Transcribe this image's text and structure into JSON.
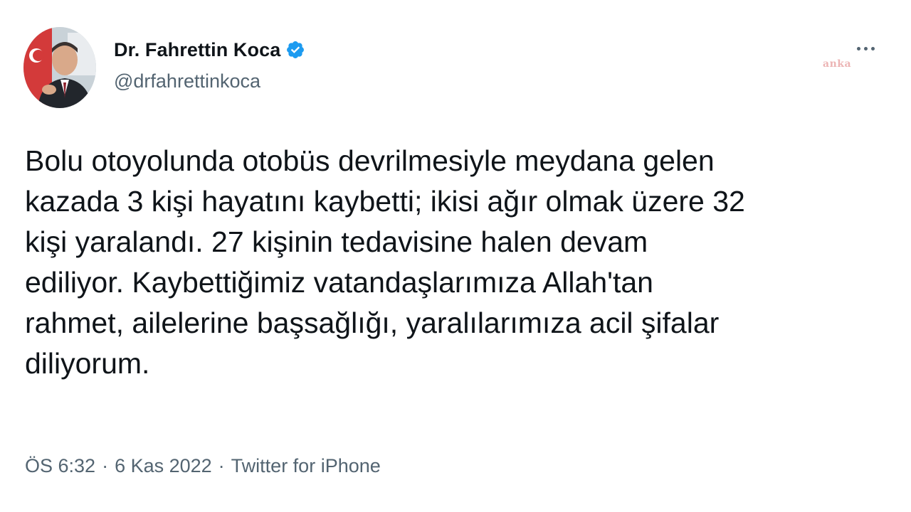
{
  "author": {
    "display_name": "Dr. Fahrettin Koca",
    "handle": "@drfahrettinkoca",
    "verified": true
  },
  "tweet": {
    "text": "Bolu otoyolunda otobüs devrilmesiyle meydana gelen\nkazada 3 kişi hayatını kaybetti; ikisi ağır olmak üzere 32\nkişi yaralandı. 27 kişinin tedavisine halen devam\nediliyor. Kaybettiğimiz vatandaşlarımıza Allah'tan\nrahmet, ailelerine başsağlığı, yaralılarımıza acil şifalar\ndiliyorum."
  },
  "meta": {
    "time": "ÖS 6:32",
    "separator": "·",
    "date": "6 Kas 2022",
    "source": "Twitter for iPhone"
  },
  "watermark": {
    "text": "anka"
  },
  "colors": {
    "text_primary": "#0f1419",
    "text_secondary": "#536471",
    "verified_blue": "#1d9bf0"
  },
  "icons": {
    "verified": "verified-badge-icon",
    "more": "more-dots-icon"
  }
}
